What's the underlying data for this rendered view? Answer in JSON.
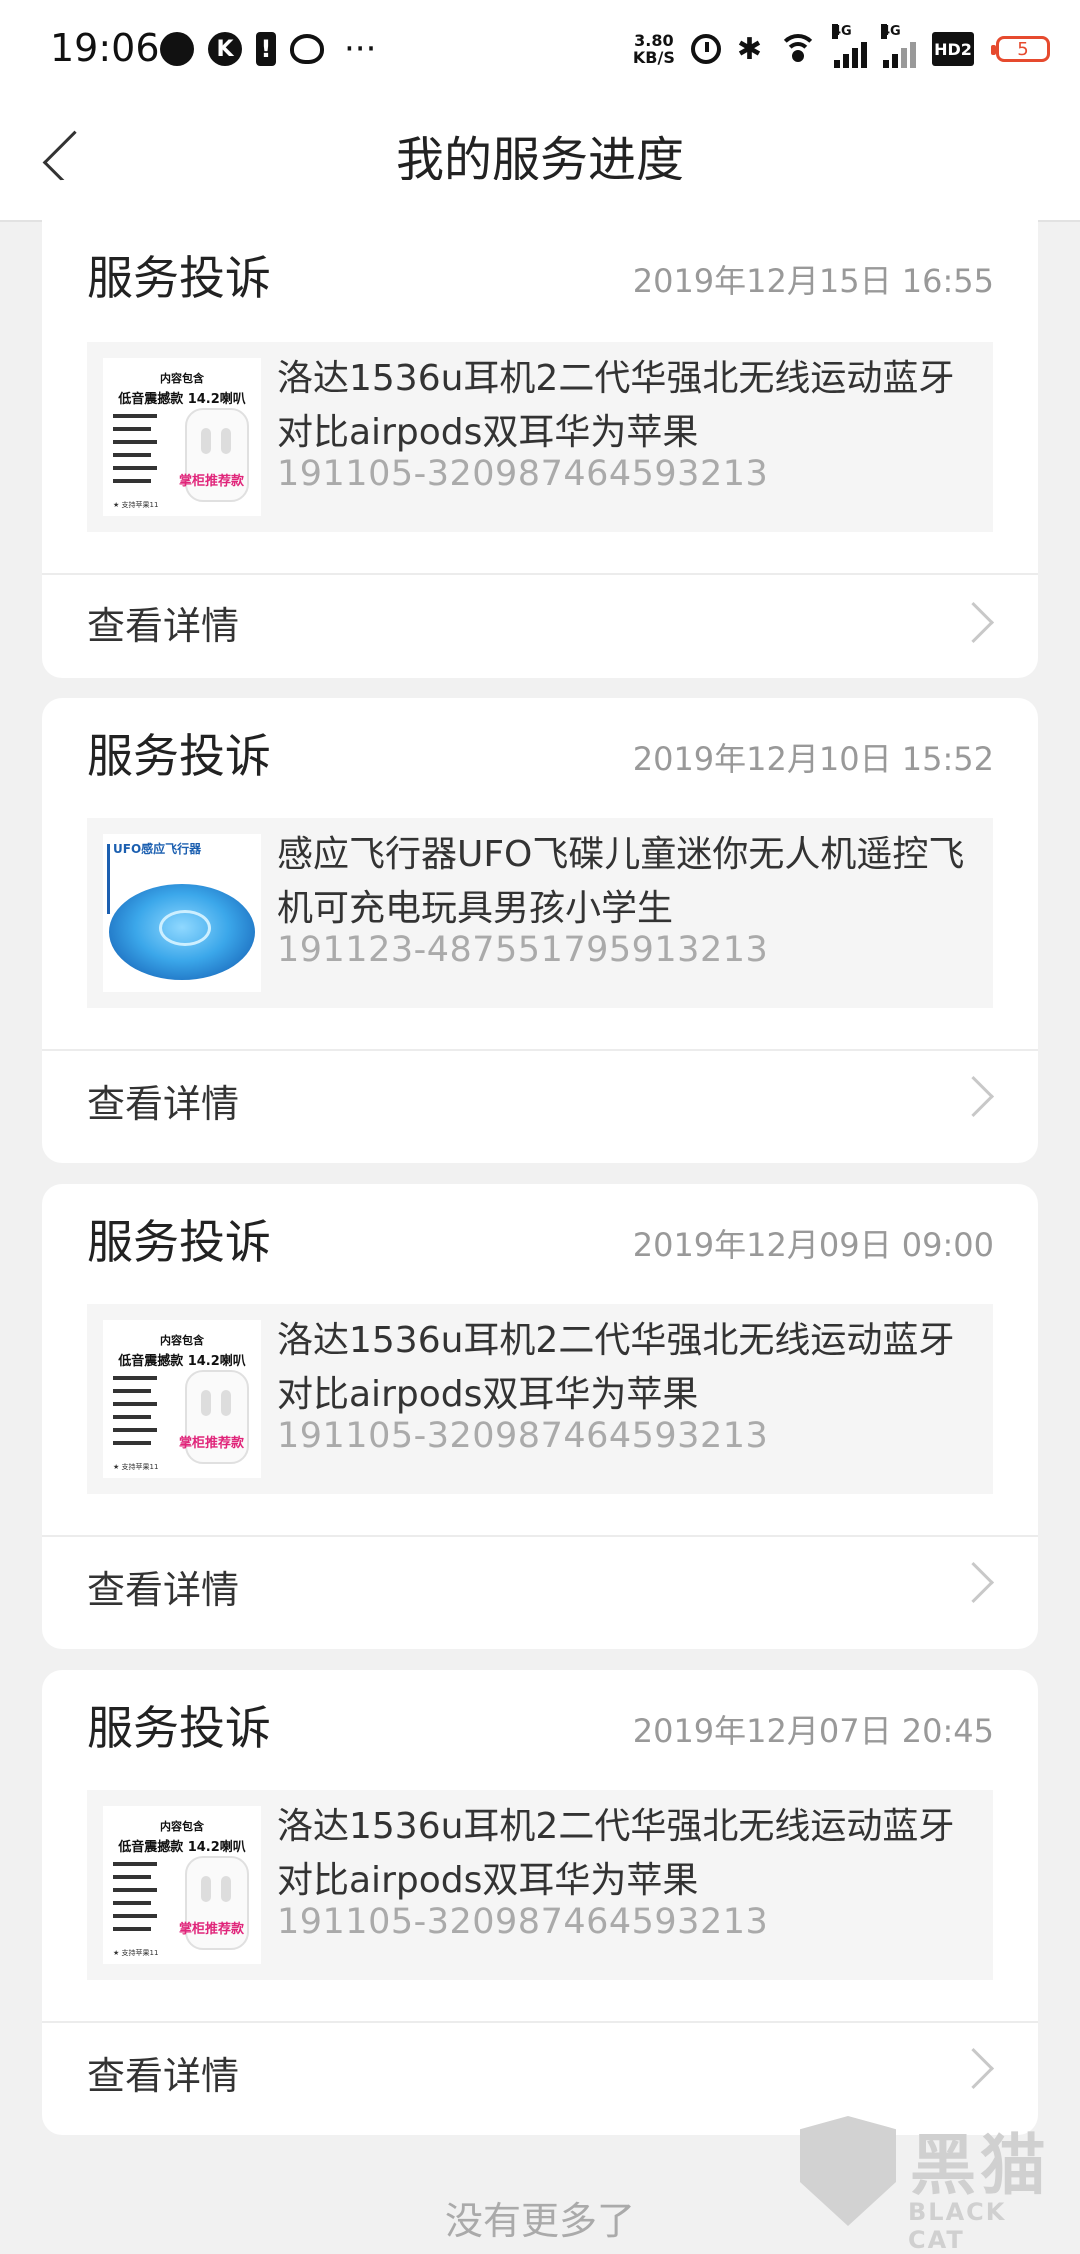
{
  "status_bar": {
    "time": "19:06",
    "k_label": "K",
    "excl_label": "!",
    "more": "···",
    "speed_value": "3.80",
    "speed_unit": "KB/S",
    "net1": "4G",
    "net2": "4G",
    "hd": "HD2",
    "battery": "5",
    "icons": [
      "chat-icon",
      "k-app-icon",
      "alert-icon",
      "weibo-icon",
      "alarm-icon",
      "bluetooth-icon",
      "wifi-icon",
      "signal-icon",
      "hd-icon",
      "battery-icon"
    ]
  },
  "header": {
    "title": "我的服务进度"
  },
  "cards": [
    {
      "type": "服务投诉",
      "date": "2019年12月15日 16:55",
      "product_name": "洛达1536u耳机2二代华强北无线运动蓝牙对比airpods双耳华为苹果",
      "order_no": "191105-320987464593213",
      "detail_label": "查看详情",
      "thumb": "earphone"
    },
    {
      "type": "服务投诉",
      "date": "2019年12月10日 15:52",
      "product_name": "感应飞行器UFO飞碟儿童迷你无人机遥控飞机可充电玩具男孩小学生",
      "order_no": "191123-487551795913213",
      "detail_label": "查看详情",
      "thumb": "ufo"
    },
    {
      "type": "服务投诉",
      "date": "2019年12月09日 09:00",
      "product_name": "洛达1536u耳机2二代华强北无线运动蓝牙对比airpods双耳华为苹果",
      "order_no": "191105-320987464593213",
      "detail_label": "查看详情",
      "thumb": "earphone"
    },
    {
      "type": "服务投诉",
      "date": "2019年12月07日 20:45",
      "product_name": "洛达1536u耳机2二代华强北无线运动蓝牙对比airpods双耳华为苹果",
      "order_no": "191105-320987464593213",
      "detail_label": "查看详情",
      "thumb": "earphone"
    }
  ],
  "thumbs": {
    "earphone": {
      "line1": "内容包含",
      "line2": "低音震撼款 14.2喇叭",
      "badge": "掌柜推荐款",
      "small": "★ 支持苹果11"
    },
    "ufo": {
      "title": "UFO感应飞行器"
    }
  },
  "footer": {
    "no_more": "没有更多了"
  },
  "watermark": {
    "cn": "黑猫",
    "en": "BLACK CAT"
  }
}
